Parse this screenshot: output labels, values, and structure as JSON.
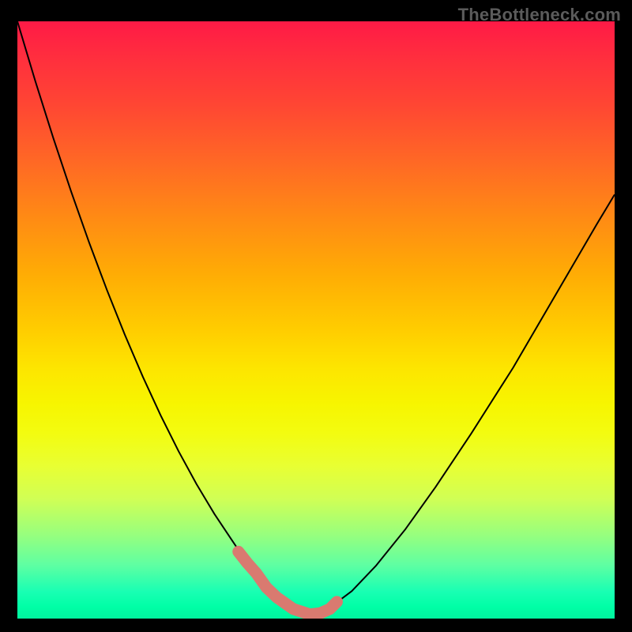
{
  "watermark": "TheBottleneck.com",
  "chart_data": {
    "type": "line",
    "title": "",
    "xlabel": "",
    "ylabel": "",
    "xlim": [
      0,
      100
    ],
    "ylim": [
      0,
      100
    ],
    "grid": false,
    "legend": false,
    "background_gradient": {
      "direction": "top-to-bottom",
      "stops": [
        {
          "pos": 0,
          "color": "#ff1a46"
        },
        {
          "pos": 14,
          "color": "#ff4633"
        },
        {
          "pos": 33,
          "color": "#ff8b14"
        },
        {
          "pos": 52,
          "color": "#ffce00"
        },
        {
          "pos": 69,
          "color": "#f3fc10"
        },
        {
          "pos": 86,
          "color": "#97ff7e"
        },
        {
          "pos": 100,
          "color": "#00f59e"
        }
      ]
    },
    "series": [
      {
        "name": "black-curve",
        "stroke": "#000000",
        "stroke_width": 2,
        "x": [
          0,
          3,
          6,
          9,
          12,
          15,
          18,
          21,
          24,
          27,
          30,
          33,
          36,
          38.5,
          41,
          44,
          46.5,
          49,
          52,
          56,
          60,
          65,
          70,
          76,
          83,
          90,
          97,
          100
        ],
        "y": [
          100,
          90,
          80.5,
          71.5,
          63,
          55,
          47.5,
          40.5,
          34,
          28,
          22.5,
          17.5,
          13,
          9.3,
          6,
          3.2,
          1.5,
          0.7,
          1.6,
          4.6,
          8.8,
          15,
          22,
          31,
          42,
          54,
          66,
          71
        ]
      },
      {
        "name": "salmon-highlight",
        "stroke": "#d97a70",
        "stroke_width": 15,
        "linecap": "round",
        "x": [
          37,
          38.5,
          40,
          41.7,
          43.5,
          46.2,
          49,
          50.7,
          52.3,
          53.5
        ],
        "y": [
          11.2,
          9.3,
          7.6,
          5.2,
          3.5,
          1.6,
          0.7,
          0.9,
          1.6,
          2.8
        ]
      }
    ]
  }
}
